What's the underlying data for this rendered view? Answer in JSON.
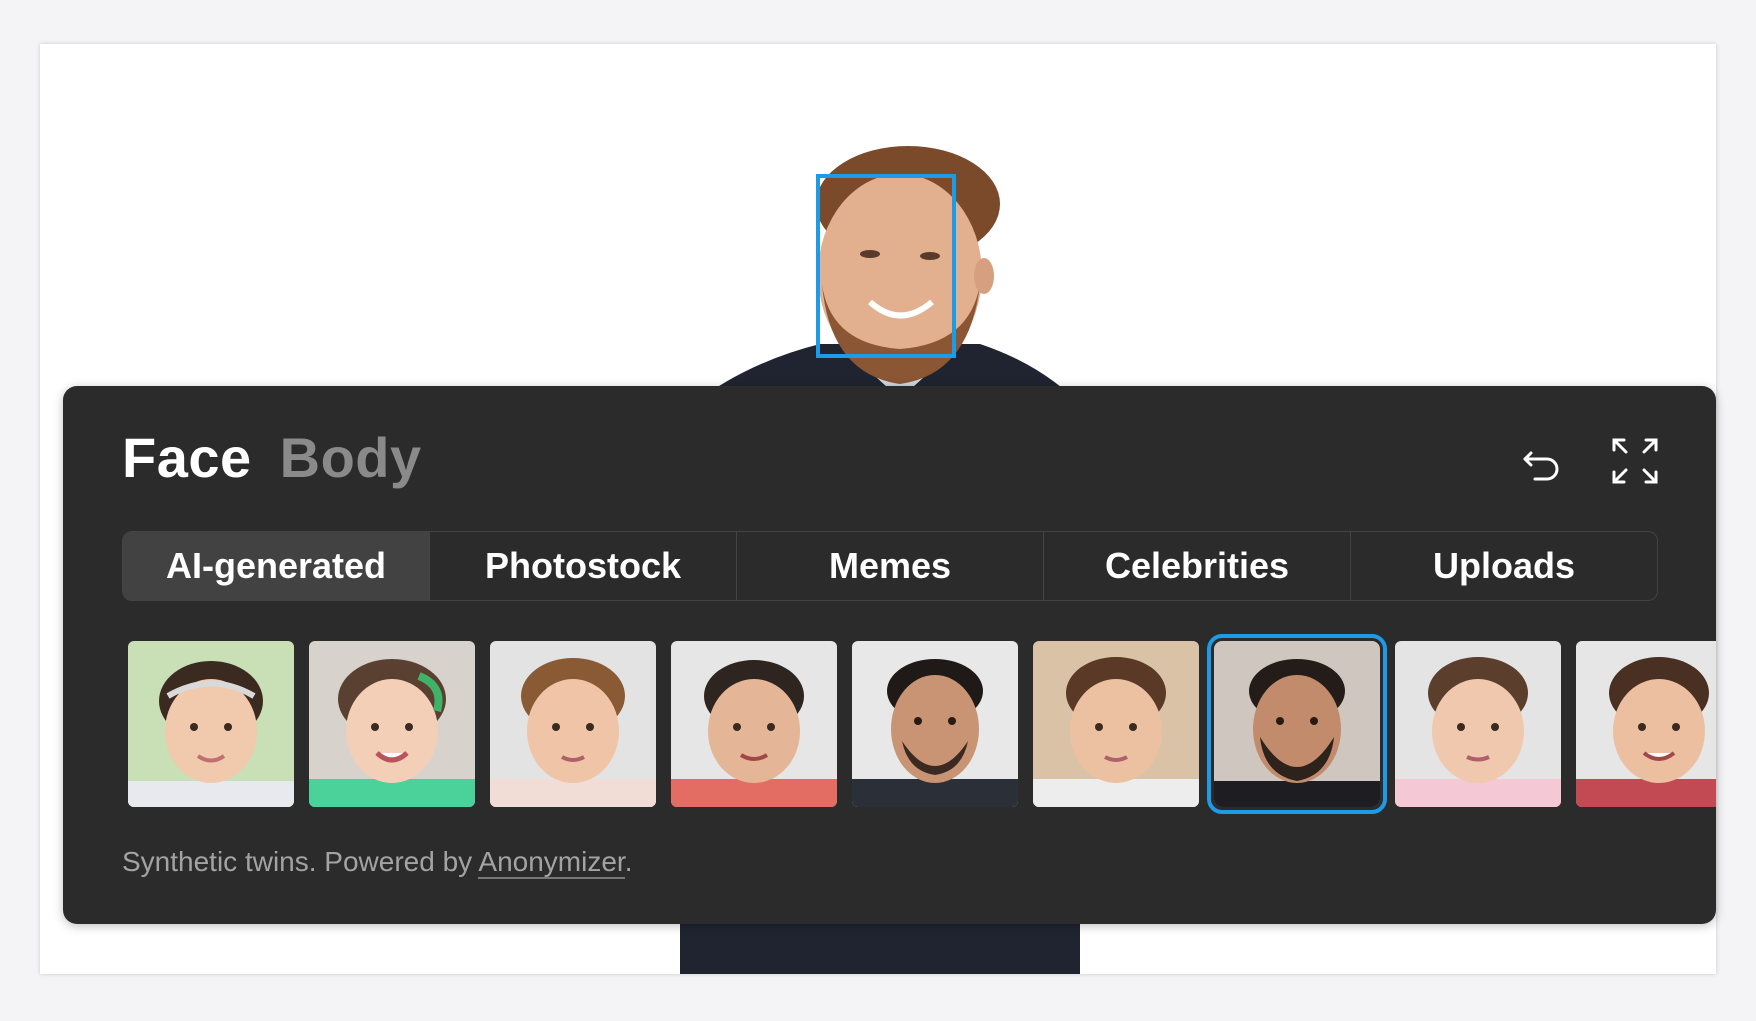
{
  "panel": {
    "mode_tabs": [
      {
        "label": "Face",
        "active": true
      },
      {
        "label": "Body",
        "active": false
      }
    ],
    "undo_icon": "undo-icon",
    "fullscreen_icon": "fullscreen-icon",
    "source_tabs": [
      {
        "label": "AI-generated",
        "active": true
      },
      {
        "label": "Photostock",
        "active": false
      },
      {
        "label": "Memes",
        "active": false
      },
      {
        "label": "Celebrities",
        "active": false
      },
      {
        "label": "Uploads",
        "active": false
      }
    ],
    "footer": {
      "prefix": "Synthetic twins. Powered by ",
      "link": "Anonymizer",
      "suffix": "."
    },
    "selected_thumbnail_index": 6
  },
  "colors": {
    "accent": "#1e9be6",
    "panel_bg": "#2b2b2b",
    "active_tab_bg": "#424242"
  }
}
